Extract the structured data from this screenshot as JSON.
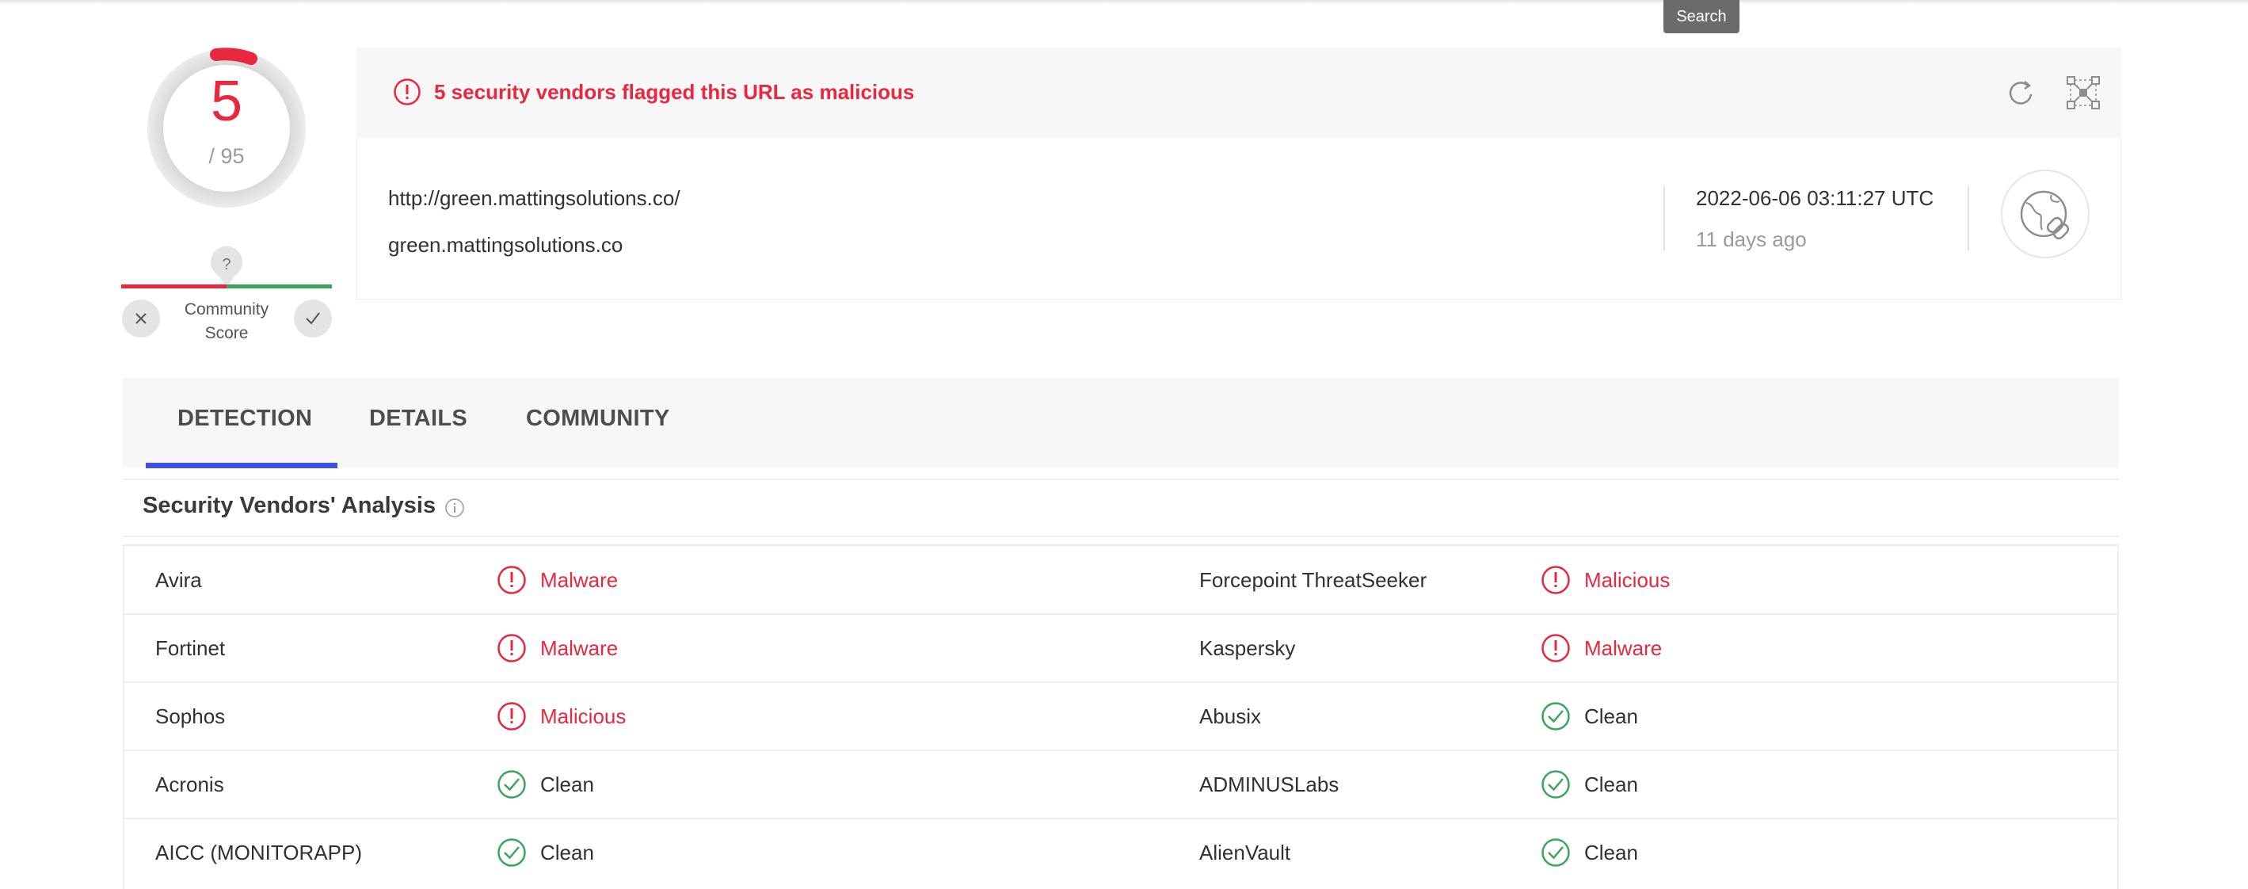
{
  "tooltip": "Search",
  "score": {
    "detections": "5",
    "total": "/ 95",
    "community_label_line1": "Community",
    "community_label_line2": "Score",
    "community_marker": "?"
  },
  "banner": {
    "text": "5 security vendors flagged this URL as malicious"
  },
  "target": {
    "url": "http://green.mattingsolutions.co/",
    "domain": "green.mattingsolutions.co",
    "scan_date": "2022-06-06 03:11:27 UTC",
    "relative_time": "11 days ago"
  },
  "tabs": [
    {
      "label": "DETECTION"
    },
    {
      "label": "DETAILS"
    },
    {
      "label": "COMMUNITY"
    }
  ],
  "active_tab": "DETECTION",
  "section": {
    "title": "Security Vendors' Analysis"
  },
  "vendors": [
    [
      {
        "name": "Avira",
        "result": "Malware",
        "status": "malicious"
      },
      {
        "name": "Forcepoint ThreatSeeker",
        "result": "Malicious",
        "status": "malicious"
      }
    ],
    [
      {
        "name": "Fortinet",
        "result": "Malware",
        "status": "malicious"
      },
      {
        "name": "Kaspersky",
        "result": "Malware",
        "status": "malicious"
      }
    ],
    [
      {
        "name": "Sophos",
        "result": "Malicious",
        "status": "malicious"
      },
      {
        "name": "Abusix",
        "result": "Clean",
        "status": "clean"
      }
    ],
    [
      {
        "name": "Acronis",
        "result": "Clean",
        "status": "clean"
      },
      {
        "name": "ADMINUSLabs",
        "result": "Clean",
        "status": "clean"
      }
    ],
    [
      {
        "name": "AICC (MONITORAPP)",
        "result": "Clean",
        "status": "clean"
      },
      {
        "name": "AlienVault",
        "result": "Clean",
        "status": "clean"
      }
    ]
  ],
  "colors": {
    "malicious": "#e8283f",
    "clean": "#3ca55c",
    "accent": "#3f51e3"
  },
  "icons": {
    "malicious": "exclamation-circle-icon",
    "clean": "check-circle-icon",
    "refresh": "refresh-icon",
    "graph": "graph-icon",
    "url": "globe-link-icon",
    "info": "info-icon"
  }
}
